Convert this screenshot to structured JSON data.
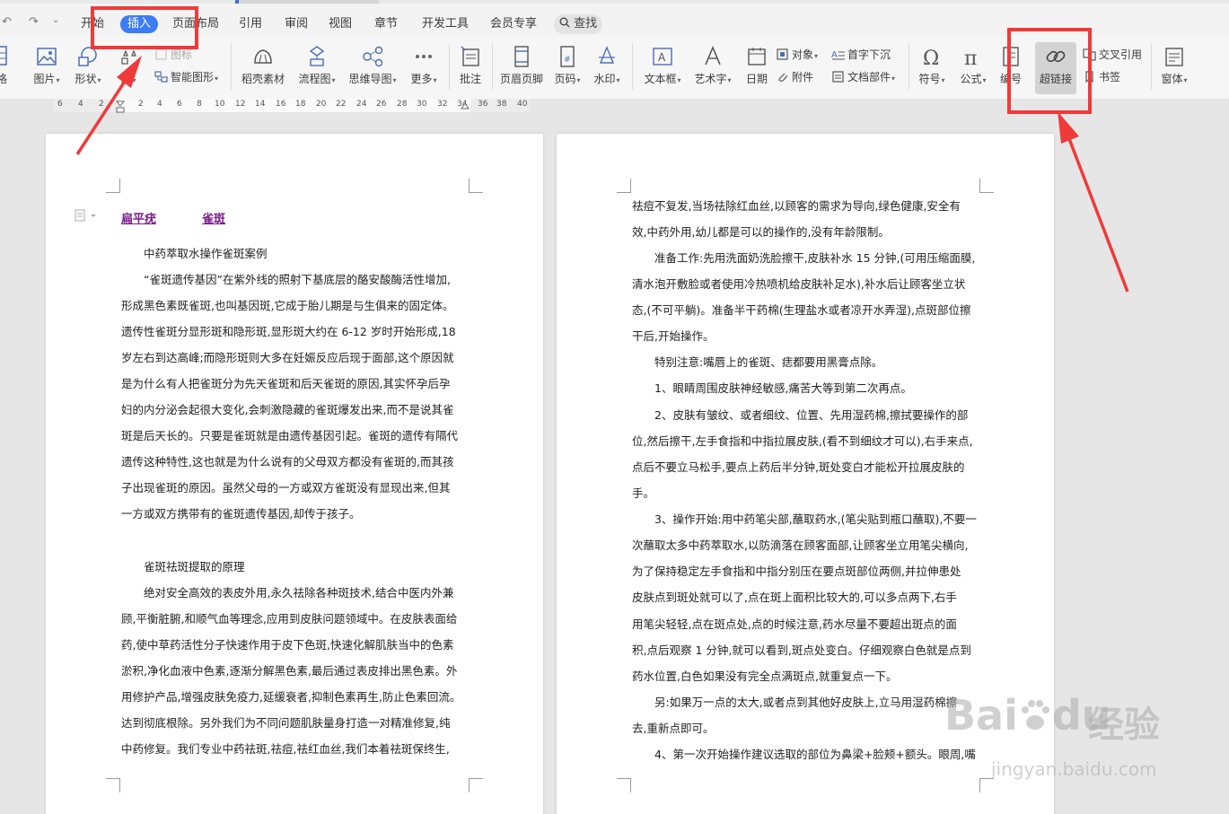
{
  "quick_access": {
    "undo_icon": "undo-icon",
    "redo_icon": "redo-icon",
    "more_icon": "chevron-down-icon"
  },
  "menu": [
    {
      "label": "开始",
      "active": false
    },
    {
      "label": "插入",
      "active": true
    },
    {
      "label": "页面布局",
      "active": false
    },
    {
      "label": "引用",
      "active": false
    },
    {
      "label": "审阅",
      "active": false
    },
    {
      "label": "视图",
      "active": false
    },
    {
      "label": "章节",
      "active": false
    },
    {
      "label": "开发工具",
      "active": false
    },
    {
      "label": "会员专享",
      "active": false
    }
  ],
  "search_label": "查找",
  "ribbon": {
    "partial_left": "格",
    "picture": "图片",
    "shape": "形状",
    "icon_lib": "图标",
    "chart_partial": "图",
    "smart_shape": "智能图形",
    "shell_material": "稻壳素材",
    "flowchart": "流程图",
    "mindmap": "思维导图",
    "more": "更多",
    "comment": "批注",
    "header_footer": "页眉页脚",
    "page_number": "页码",
    "watermark": "水印",
    "textbox": "文本框",
    "wordart": "艺术字",
    "date": "日期",
    "object": "对象",
    "attachment": "附件",
    "drop_cap": "首字下沉",
    "doc_parts": "文档部件",
    "symbol": "符号",
    "formula": "公式",
    "numbering_partial": "编号",
    "hyperlink": "超链接",
    "cross_ref": "交叉引用",
    "bookmark": "书签",
    "window": "窗体"
  },
  "ruler_numbers": [
    "6",
    "4",
    "2",
    "2",
    "4",
    "6",
    "8",
    "10",
    "12",
    "14",
    "16",
    "18",
    "20",
    "22",
    "24",
    "26",
    "28",
    "30",
    "32",
    "34",
    "36",
    "38",
    "40"
  ],
  "left_page": {
    "link1": "扁平疣",
    "link2": "雀斑",
    "lines": [
      "中药萃取水操作雀斑案例",
      "“雀斑遗传基因”在紫外线的照射下基底层的酪安酸酶活性增加,",
      "形成黑色素既雀斑,也叫基因斑,它成于胎儿期是与生俱来的固定体。",
      "遗传性雀斑分显形斑和隐形斑,显形斑大约在 6-12 岁时开始形成,18",
      "岁左右到达高峰;而隐形斑则大多在妊娠反应后现于面部,这个原因就",
      "是为什么有人把雀斑分为先天雀斑和后天雀斑的原因,其实怀孕后孕",
      "妇的内分泌会起很大变化,会刺激隐藏的雀斑爆发出来,而不是说其雀",
      "斑是后天长的。只要是雀斑就是由遗传基因引起。雀斑的遗传有隔代",
      "遗传这种特性,这也就是为什么说有的父母双方都没有雀斑的,而其孩",
      "子出现雀斑的原因。虽然父母的一方或双方雀斑没有显现出来,但其",
      "一方或双方携带有的雀斑遗传基因,却传于孩子。",
      "",
      "雀斑祛斑提取的原理",
      "绝对安全高效的表皮外用,永久祛除各种斑技术,结合中医内外兼",
      "顾,平衡脏腑,和顺气血等理念,应用到皮肤问题领域中。在皮肤表面给",
      "药,使中草药活性分子快速作用于皮下色斑,快速化解肌肤当中的色素",
      "淤积,净化血液中色素,逐渐分解黑色素,最后通过表皮排出黑色素。外",
      "用修护产品,增强皮肤免疫力,延缓衰者,抑制色素再生,防止色素回流。",
      "达到彻底根除。另外我们为不同问题肌肤量身打造一对精准修复,纯",
      "中药修复。我们专业中药祛斑,祛痘,祛红血丝,我们本着祛斑保终生,"
    ]
  },
  "right_page": {
    "lines": [
      "祛痘不复发,当场祛除红血丝,以顾客的需求为导向,绿色健康,安全有",
      "效,中药外用,幼儿都是可以的操作的,没有年龄限制。",
      "准备工作:先用洗面奶洗脸擦干,皮肤补水 15 分钟,(可用压缩面膜,",
      "清水泡开敷脸或者使用冷热喷机给皮肤补足水),补水后让顾客坐立状",
      "态,(不可平躺)。准备半干药棉(生理盐水或者凉开水弄湿),点斑部位擦",
      "干后,开始操作。",
      "特别注意:嘴唇上的雀斑、痣都要用黑膏点除。",
      "1、眼睛周围皮肤神经敏感,痛苦大等到第二次再点。",
      "2、皮肤有皱纹、或者细纹、位置、先用湿药棉,擦拭要操作的部",
      "位,然后擦干,左手食指和中指拉展皮肤,(看不到细纹才可以),右手来点,",
      "点后不要立马松手,要点上药后半分钟,斑处变白才能松开拉展皮肤的",
      "手。",
      "3、操作开始:用中药笔尖部,蘸取药水,(笔尖贴到瓶口蘸取),不要一",
      "次蘸取太多中药萃取水,以防滴落在顾客面部,让顾客坐立用笔尖横向,",
      "为了保持稳定左手食指和中指分别压在要点斑部位两侧,并拉伸患处",
      "皮肤点到斑处就可以了,点在斑上面积比较大的,可以多点两下,右手",
      "用笔尖轻轻,点在斑点处,点的时候注意,药水尽量不要超出斑点的面",
      "积,点后观察 1 分钟,就可以看到,斑点处变白。仔细观察白色就是点到",
      "药水位置,白色如果没有完全点满斑点,就重复点一下。",
      "另:如果万一点的太大,或者点到其他好皮肤上,立马用湿药棉擦",
      "去,重新点即可。",
      "4、第一次开始操作建议选取的部位为鼻梁+脸颊+额头。眼周,嘴"
    ]
  },
  "watermark": {
    "logo": "Bai",
    "logo_paw": "du",
    "brand": "经验",
    "url": "jingyan.baidu.com"
  },
  "colors": {
    "accent": "#3c7cf4",
    "annotation_red": "#f03a3a",
    "link_purple": "#7a1f8a"
  }
}
